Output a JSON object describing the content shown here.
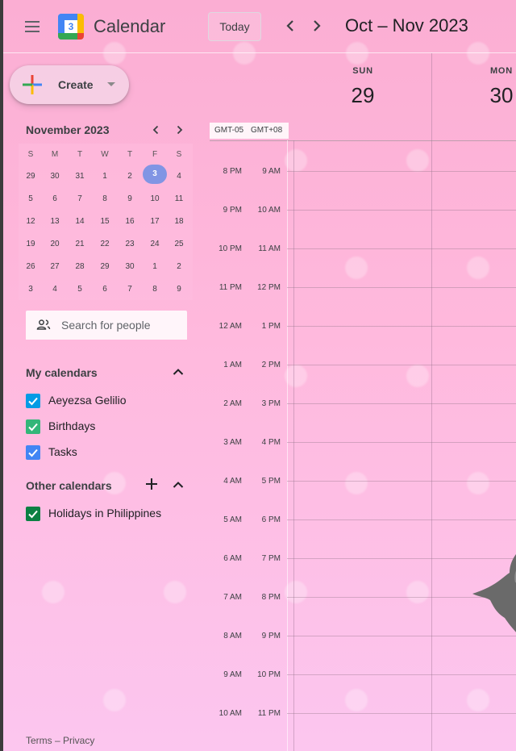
{
  "header": {
    "app_title": "Calendar",
    "logo_number": "3",
    "today_label": "Today",
    "range_title": "Oct – Nov 2023",
    "menu_icon": "hamburger-menu-icon",
    "prev_icon": "chevron-left-icon",
    "next_icon": "chevron-right-icon"
  },
  "sidebar": {
    "create_label": "Create",
    "mini_calendar": {
      "month_label": "November 2023",
      "weekday_labels": [
        "S",
        "M",
        "T",
        "W",
        "T",
        "F",
        "S"
      ],
      "weeks": [
        [
          "29",
          "30",
          "31",
          "1",
          "2",
          "3",
          "4"
        ],
        [
          "5",
          "6",
          "7",
          "8",
          "9",
          "10",
          "11"
        ],
        [
          "12",
          "13",
          "14",
          "15",
          "16",
          "17",
          "18"
        ],
        [
          "19",
          "20",
          "21",
          "22",
          "23",
          "24",
          "25"
        ],
        [
          "26",
          "27",
          "28",
          "29",
          "30",
          "1",
          "2"
        ],
        [
          "3",
          "4",
          "5",
          "6",
          "7",
          "8",
          "9"
        ]
      ],
      "selected_day": "3"
    },
    "search_placeholder": "Search for people",
    "my_calendars": {
      "title": "My calendars",
      "items": [
        {
          "label": "Aeyezsa Gelilio",
          "color": "#039be5",
          "checked": true
        },
        {
          "label": "Birthdays",
          "color": "#33b679",
          "checked": true
        },
        {
          "label": "Tasks",
          "color": "#4285f4",
          "checked": true
        }
      ]
    },
    "other_calendars": {
      "title": "Other calendars",
      "items": [
        {
          "label": "Holidays in Philippines",
          "color": "#0b8043",
          "checked": true
        }
      ]
    },
    "footer": "Terms – Privacy"
  },
  "week": {
    "days": [
      {
        "dow": "SUN",
        "num": "29"
      },
      {
        "dow": "MON",
        "num": "30"
      }
    ],
    "timezones": [
      "GMT-05",
      "GMT+08"
    ],
    "primary_times": [
      "8 PM",
      "9 PM",
      "10 PM",
      "11 PM",
      "12 AM",
      "1 AM",
      "2 AM",
      "3 AM",
      "4 AM",
      "5 AM",
      "6 AM",
      "7 AM",
      "8 AM",
      "9 AM",
      "10 AM"
    ],
    "secondary_times": [
      "9 AM",
      "10 AM",
      "11 AM",
      "12 PM",
      "1 PM",
      "2 PM",
      "3 PM",
      "4 PM",
      "5 PM",
      "6 PM",
      "7 PM",
      "8 PM",
      "9 PM",
      "10 PM",
      "11 PM"
    ]
  },
  "colors": {
    "accent": "#1a73e8",
    "background": "#fbb4d8"
  }
}
